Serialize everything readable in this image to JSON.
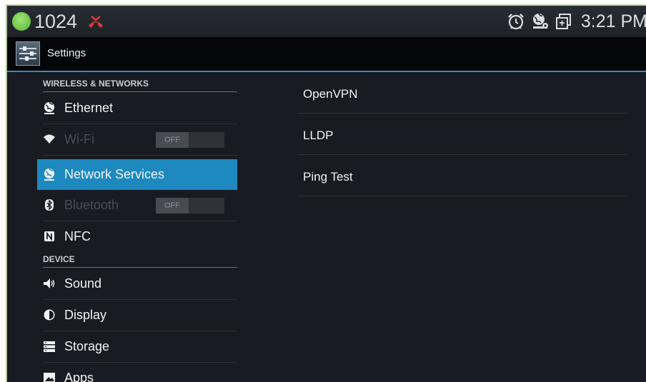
{
  "status_bar": {
    "extension": "1024",
    "time": "3:21 PM",
    "icons": [
      "alarm-clock-icon",
      "network-settings-icon",
      "screenshot-icon"
    ],
    "missed_call_icon": "missed-call-icon",
    "colors": {
      "online_dot": "#55b82e",
      "missed_call": "#e03a3a"
    }
  },
  "action_bar": {
    "title": "Settings",
    "icon": "settings-sliders-icon",
    "accent": "#2f8fc0"
  },
  "sidebar": {
    "sections": [
      {
        "header": "WIRELESS & NETWORKS"
      },
      {
        "header": "DEVICE"
      }
    ],
    "items": [
      {
        "label": "Ethernet",
        "icon": "ethernet-globe-icon"
      },
      {
        "label": "Wi-Fi",
        "icon": "wifi-icon",
        "toggle": "OFF",
        "disabled": true
      },
      {
        "label": "Network Services",
        "icon": "network-globe-icon",
        "selected": true
      },
      {
        "label": "Bluetooth",
        "icon": "bluetooth-icon",
        "toggle": "OFF",
        "disabled": true
      },
      {
        "label": "NFC",
        "icon": "nfc-icon"
      },
      {
        "label": "Sound",
        "icon": "speaker-icon"
      },
      {
        "label": "Display",
        "icon": "display-brightness-icon"
      },
      {
        "label": "Storage",
        "icon": "storage-icon"
      },
      {
        "label": "Apps",
        "icon": "apps-image-icon"
      }
    ],
    "selected_color": "#1e89bf"
  },
  "detail": {
    "items": [
      {
        "label": "OpenVPN"
      },
      {
        "label": "LLDP"
      },
      {
        "label": "Ping Test"
      }
    ]
  }
}
